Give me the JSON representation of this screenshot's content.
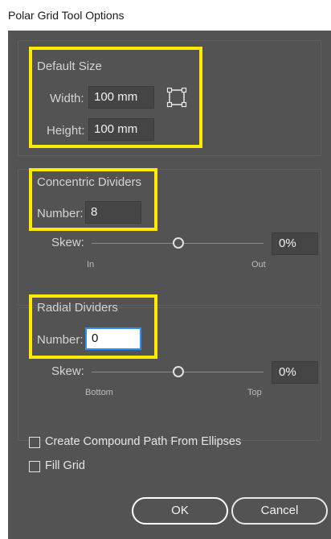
{
  "window": {
    "title": "Polar Grid Tool Options"
  },
  "default_size": {
    "heading": "Default Size",
    "width_label": "Width:",
    "width_value": "100 mm",
    "height_label": "Height:",
    "height_value": "100 mm",
    "origin_icon": "reference-point-icon"
  },
  "concentric": {
    "heading": "Concentric Dividers",
    "number_label": "Number:",
    "number_value": "8",
    "skew_label": "Skew:",
    "skew_value": "0%",
    "skew_level": 0.5,
    "min_label": "In",
    "max_label": "Out"
  },
  "radial": {
    "heading": "Radial Dividers",
    "number_label": "Number:",
    "number_value": "0",
    "skew_label": "Skew:",
    "skew_value": "0%",
    "skew_level": 0.5,
    "min_label": "Bottom",
    "max_label": "Top"
  },
  "options": {
    "compound_label": "Create Compound Path From Ellipses",
    "compound_checked": false,
    "fill_label": "Fill Grid",
    "fill_checked": false
  },
  "buttons": {
    "ok": "OK",
    "cancel": "Cancel"
  },
  "colors": {
    "highlight": "#ffea00",
    "panel": "#535353",
    "focus": "#2f8eff"
  }
}
